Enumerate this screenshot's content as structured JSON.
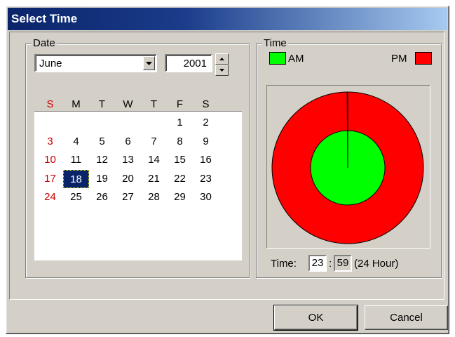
{
  "window": {
    "title": "Select Time"
  },
  "date_group": {
    "label": "Date",
    "month_value": "June",
    "year_value": "2001"
  },
  "calendar": {
    "weekdays": [
      "S",
      "M",
      "T",
      "W",
      "T",
      "F",
      "S"
    ],
    "weeks": [
      [
        "",
        "",
        "",
        "",
        "",
        "1",
        "2"
      ],
      [
        "3",
        "4",
        "5",
        "6",
        "7",
        "8",
        "9"
      ],
      [
        "10",
        "11",
        "12",
        "13",
        "14",
        "15",
        "16"
      ],
      [
        "17",
        "18",
        "19",
        "20",
        "21",
        "22",
        "23"
      ],
      [
        "24",
        "25",
        "26",
        "27",
        "28",
        "29",
        "30"
      ]
    ],
    "selected_day": "18",
    "weekend_color": "#cc0000",
    "selection_color": "#0a246a"
  },
  "time_group": {
    "label": "Time",
    "am_label": "AM",
    "pm_label": "PM",
    "am_color": "#00ff00",
    "pm_color": "#ff0000",
    "hand_color": "#000080",
    "time_label": "Time:",
    "hour_value": "23",
    "colon": ":",
    "minute_value": "59",
    "format_label": "(24 Hour)"
  },
  "buttons": {
    "ok_label": "OK",
    "cancel_label": "Cancel"
  }
}
